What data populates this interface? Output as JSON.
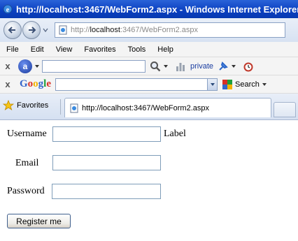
{
  "window": {
    "title": "http://localhost:3467/WebForm2.aspx - Windows Internet Explorer"
  },
  "address_bar": {
    "url_prefix": "http://",
    "url_host": "localhost",
    "url_rest": ":3467/WebForm2.aspx"
  },
  "menu": {
    "items": [
      "File",
      "Edit",
      "View",
      "Favorites",
      "Tools",
      "Help"
    ]
  },
  "toolbar1": {
    "close_label": "x",
    "logo_letter": "a",
    "private_label": "private"
  },
  "toolbar2": {
    "close_label": "x",
    "google_label": "Google",
    "search_label": "Search"
  },
  "favorites": {
    "label": "Favorites"
  },
  "tab": {
    "label": "http://localhost:3467/WebForm2.aspx"
  },
  "form": {
    "username_label": "Username",
    "username_value": "",
    "side_label": "Label",
    "email_label": "Email",
    "email_value": "",
    "password_label": "Password",
    "password_value": "",
    "register_button": "Register me"
  }
}
